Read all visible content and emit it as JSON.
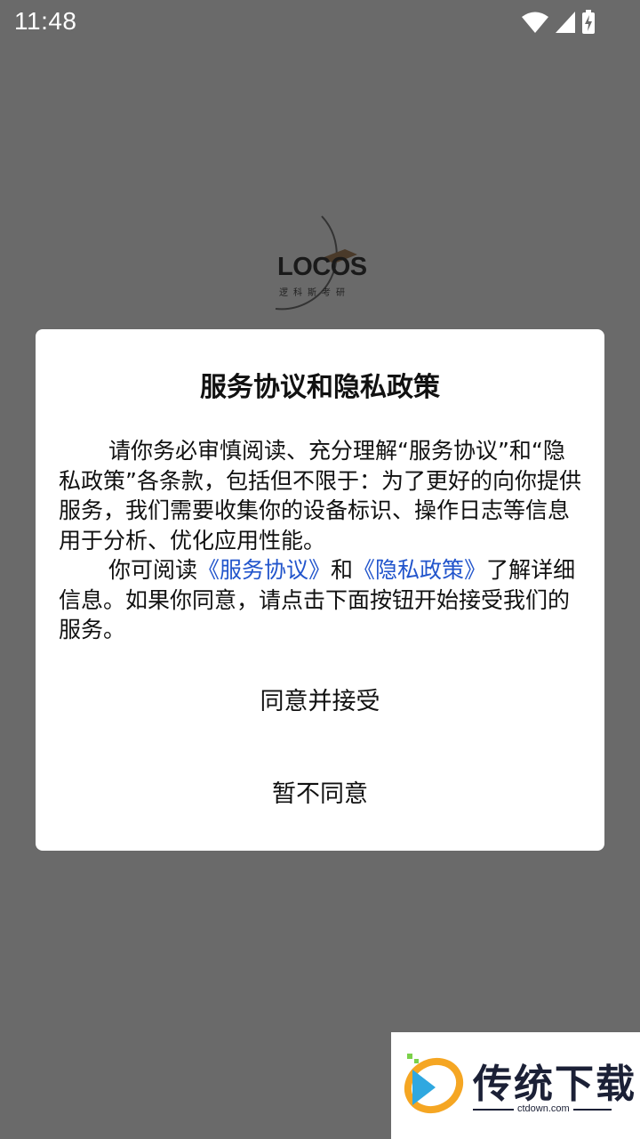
{
  "status_bar": {
    "time": "11:48",
    "icons": [
      "wifi-icon",
      "signal-icon",
      "battery-charging-icon"
    ]
  },
  "splash": {
    "logo_text": "LOCOS",
    "logo_subtitle": "逻科斯考研"
  },
  "dialog": {
    "title": "服务协议和隐私政策",
    "para1": "请你务必审慎阅读、充分理解“服务协议”和“隐私政策”各条款，包括但不限于：为了更好的向你提供服务，我们需要收集你的设备标识、操作日志等信息用于分析、优化应用性能。",
    "para2_prefix": "你可阅读",
    "link_service": "《服务协议》",
    "para2_and": "和",
    "link_privacy": "《隐私政策》",
    "para2_suffix": "了解详细信息。如果你同意，请点击下面按钮开始接受我们的服务。",
    "agree_label": "同意并接受",
    "disagree_label": "暂不同意",
    "link_color": "#2255cc"
  },
  "watermark": {
    "brand": "传统下载",
    "url": "ctdown.com"
  }
}
